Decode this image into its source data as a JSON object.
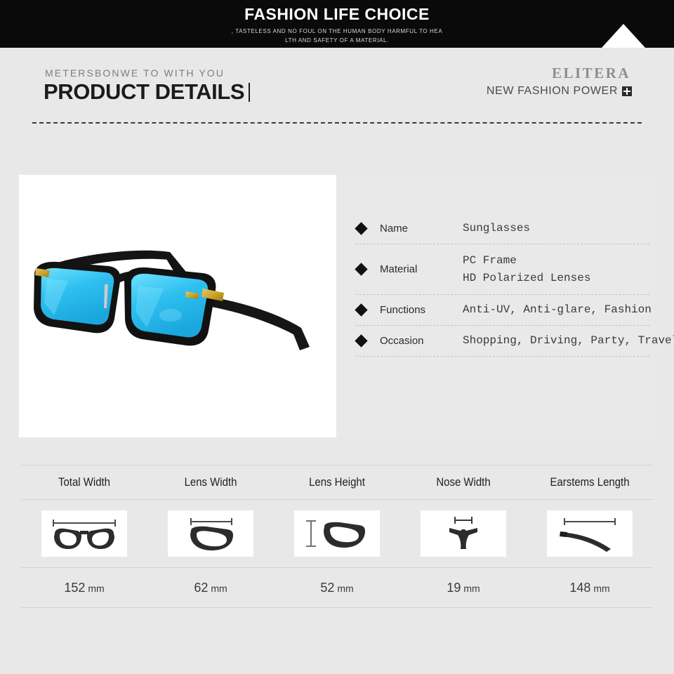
{
  "banner": {
    "title": "FASHION LIFE CHOICE",
    "subtitle_line1": ", TASTELESS AND NO FOUL ON THE HUMAN BODY HARMFUL TO HEA",
    "subtitle_line2": "LTH AND SAFETY OF A MATERIAL.",
    "background_color": "#0a0a0a",
    "triangle_color": "#ffffff"
  },
  "title_zone": {
    "kicker": "METERSBONWE TO WITH YOU",
    "headline": "PRODUCT DETAILS",
    "brand_name": "ELITERA",
    "brand_tagline": "NEW FASHION POWER",
    "brand_badge_icon": "plus-square-icon"
  },
  "product": {
    "photo_alt": "sunglasses-product-photo",
    "frame_color": "#1a1a1a",
    "lens_color": "#3fc3ef",
    "accent_color": "#c9a227",
    "specs": [
      {
        "label": "Name",
        "value": "Sunglasses",
        "bullet": "diamond-icon"
      },
      {
        "label": "Material",
        "value": "PC Frame\nHD Polarized Lenses",
        "bullet": "diamond-icon"
      },
      {
        "label": "Functions",
        "value": "Anti-UV, Anti-glare, Fashion",
        "bullet": "diamond-icon"
      },
      {
        "label": "Occasion",
        "value": "Shopping, Driving, Party, Travel",
        "bullet": "diamond-icon"
      }
    ]
  },
  "measurements": {
    "headers": [
      "Total Width",
      "Lens Width",
      "Lens Height",
      "Nose Width",
      "Earstems Length"
    ],
    "icons": [
      "total-width-icon",
      "lens-width-icon",
      "lens-height-icon",
      "nose-width-icon",
      "earstems-length-icon"
    ],
    "values": [
      "152",
      "62",
      "52",
      "19",
      "148"
    ],
    "unit": "mm"
  }
}
